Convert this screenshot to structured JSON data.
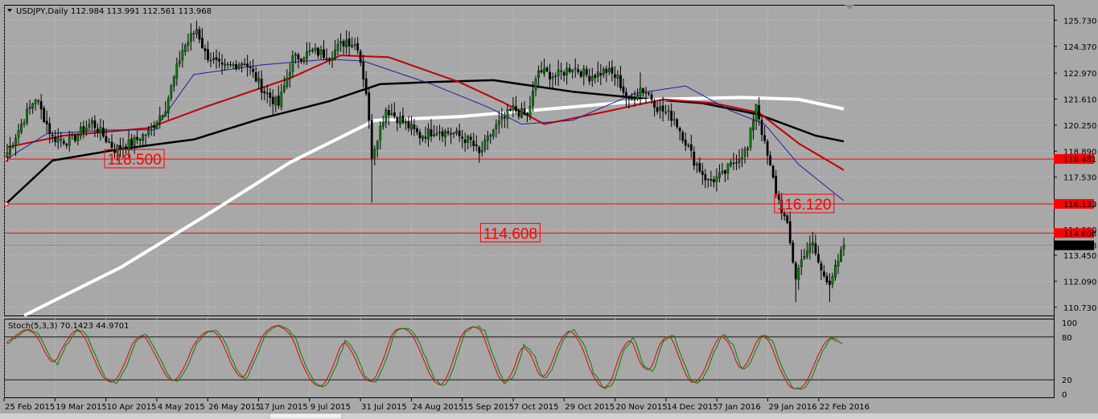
{
  "header": {
    "symbol": "USDJPY,Daily",
    "ohlc": "112.984 113.991 112.561 113.968"
  },
  "stoch": {
    "label": "Stoch(5,3,3) 70.1423 44.9701",
    "scale": [
      "100",
      "80",
      "20",
      "0"
    ]
  },
  "chart_data": {
    "type": "candlestick",
    "ylim": [
      110.3,
      126.5
    ],
    "y_ticks": [
      "125.730",
      "124.370",
      "122.970",
      "121.610",
      "120.250",
      "118.890",
      "117.530",
      "116.130",
      "114.800",
      "113.450",
      "112.090",
      "110.730"
    ],
    "x_labels": [
      "25 Feb 2015",
      "19 Mar 2015",
      "10 Apr 2015",
      "4 May 2015",
      "26 May 2015",
      "17 Jun 2015",
      "9 Jul 2015",
      "31 Jul 2015",
      "24 Aug 2015",
      "15 Sep 2015",
      "7 Oct 2015",
      "29 Oct 2015",
      "20 Nov 2015",
      "14 Dec 2015",
      "7 Jan 2016",
      "29 Jan 2016",
      "22 Feb 2016"
    ],
    "close_keypoints": [
      [
        0,
        118.8
      ],
      [
        6,
        120.6
      ],
      [
        10,
        121.7
      ],
      [
        16,
        119.6
      ],
      [
        22,
        119.4
      ],
      [
        30,
        120.4
      ],
      [
        38,
        119.0
      ],
      [
        44,
        119.3
      ],
      [
        50,
        119.9
      ],
      [
        56,
        121.2
      ],
      [
        62,
        124.2
      ],
      [
        67,
        125.3
      ],
      [
        70,
        124.0
      ],
      [
        76,
        123.2
      ],
      [
        84,
        123.6
      ],
      [
        91,
        122.0
      ],
      [
        96,
        121.3
      ],
      [
        101,
        123.7
      ],
      [
        108,
        124.1
      ],
      [
        114,
        123.9
      ],
      [
        120,
        124.7
      ],
      [
        124,
        124.4
      ],
      [
        127,
        122.0
      ],
      [
        129,
        118.7
      ],
      [
        134,
        121.1
      ],
      [
        141,
        120.3
      ],
      [
        146,
        119.7
      ],
      [
        152,
        120.0
      ],
      [
        158,
        119.8
      ],
      [
        164,
        119.4
      ],
      [
        167,
        118.7
      ],
      [
        172,
        120.0
      ],
      [
        179,
        121.1
      ],
      [
        184,
        120.7
      ],
      [
        188,
        123.1
      ],
      [
        194,
        122.8
      ],
      [
        200,
        123.3
      ],
      [
        206,
        122.8
      ],
      [
        212,
        123.1
      ],
      [
        216,
        122.7
      ],
      [
        220,
        121.4
      ],
      [
        224,
        122.2
      ],
      [
        227,
        121.9
      ],
      [
        230,
        121.2
      ],
      [
        236,
        120.6
      ],
      [
        240,
        119.4
      ],
      [
        243,
        118.4
      ],
      [
        248,
        117.3
      ],
      [
        253,
        117.6
      ],
      [
        258,
        118.5
      ],
      [
        262,
        119.0
      ],
      [
        265,
        121.4
      ],
      [
        268,
        119.2
      ],
      [
        272,
        116.8
      ],
      [
        276,
        114.9
      ],
      [
        279,
        112.3
      ],
      [
        282,
        113.6
      ],
      [
        285,
        114.0
      ],
      [
        288,
        112.6
      ],
      [
        291,
        112.1
      ],
      [
        294,
        113.0
      ],
      [
        296,
        113.968
      ]
    ],
    "moving_averages": [
      {
        "color": "#000000",
        "width": 2.5,
        "points": [
          [
            0,
            116.2
          ],
          [
            16,
            118.4
          ],
          [
            40,
            119.0
          ],
          [
            66,
            119.5
          ],
          [
            90,
            120.6
          ],
          [
            114,
            121.5
          ],
          [
            132,
            122.4
          ],
          [
            150,
            122.5
          ],
          [
            172,
            122.6
          ],
          [
            200,
            122.0
          ],
          [
            228,
            121.6
          ],
          [
            246,
            121.4
          ],
          [
            266,
            120.8
          ],
          [
            286,
            119.7
          ],
          [
            296,
            119.4
          ]
        ]
      },
      {
        "color": "#ffffff",
        "width": 4,
        "points": [
          [
            6,
            110.3
          ],
          [
            40,
            112.8
          ],
          [
            70,
            115.5
          ],
          [
            100,
            118.3
          ],
          [
            130,
            120.5
          ],
          [
            160,
            120.7
          ],
          [
            200,
            121.2
          ],
          [
            230,
            121.6
          ],
          [
            260,
            121.7
          ],
          [
            280,
            121.6
          ],
          [
            296,
            121.1
          ]
        ]
      },
      {
        "color": "#c00000",
        "width": 2,
        "points": [
          [
            0,
            119.1
          ],
          [
            20,
            119.7
          ],
          [
            50,
            120.1
          ],
          [
            70,
            121.2
          ],
          [
            100,
            122.7
          ],
          [
            118,
            123.9
          ],
          [
            135,
            123.8
          ],
          [
            160,
            122.5
          ],
          [
            176,
            121.4
          ],
          [
            190,
            120.3
          ],
          [
            210,
            120.9
          ],
          [
            232,
            121.6
          ],
          [
            250,
            121.4
          ],
          [
            266,
            120.9
          ],
          [
            280,
            119.3
          ],
          [
            296,
            117.9
          ]
        ]
      },
      {
        "color": "#2020a0",
        "width": 1,
        "points": [
          [
            0,
            118.5
          ],
          [
            14,
            119.8
          ],
          [
            36,
            120.0
          ],
          [
            52,
            120.0
          ],
          [
            66,
            122.9
          ],
          [
            90,
            123.4
          ],
          [
            114,
            123.7
          ],
          [
            126,
            123.6
          ],
          [
            150,
            122.4
          ],
          [
            170,
            121.2
          ],
          [
            182,
            120.3
          ],
          [
            200,
            120.5
          ],
          [
            222,
            121.9
          ],
          [
            240,
            122.3
          ],
          [
            256,
            121.0
          ],
          [
            268,
            120.3
          ],
          [
            280,
            118.2
          ],
          [
            296,
            116.3
          ]
        ]
      }
    ],
    "hlines": [
      {
        "value": 118.481,
        "label": "118.481",
        "annotation": "118.500",
        "ann_index": 45
      },
      {
        "value": 116.132,
        "label": "116.132",
        "annotation": "116.120",
        "ann_index": 282
      },
      {
        "value": 114.608,
        "label": "114.608",
        "annotation": "114.608",
        "ann_index": 178
      }
    ],
    "current_price": "113.968",
    "stochastic": {
      "k_color": "#008000",
      "d_color": "#e00000",
      "levels": [
        80,
        20
      ],
      "ylim": [
        0,
        100
      ],
      "k_values": [
        70,
        80,
        92,
        88,
        60,
        40,
        70,
        90,
        85,
        50,
        20,
        15,
        40,
        75,
        85,
        60,
        30,
        15,
        35,
        70,
        85,
        92,
        70,
        35,
        20,
        50,
        85,
        95,
        93,
        80,
        40,
        15,
        10,
        35,
        75,
        60,
        25,
        15,
        45,
        85,
        95,
        85,
        55,
        20,
        10,
        40,
        85,
        96,
        90,
        50,
        15,
        25,
        70,
        55,
        20,
        40,
        80,
        90,
        70,
        30,
        8,
        15,
        60,
        80,
        40,
        30,
        75,
        85,
        45,
        15,
        20,
        55,
        85,
        70,
        30,
        50,
        85,
        75,
        35,
        10,
        5,
        25,
        60,
        80,
        70
      ]
    }
  }
}
